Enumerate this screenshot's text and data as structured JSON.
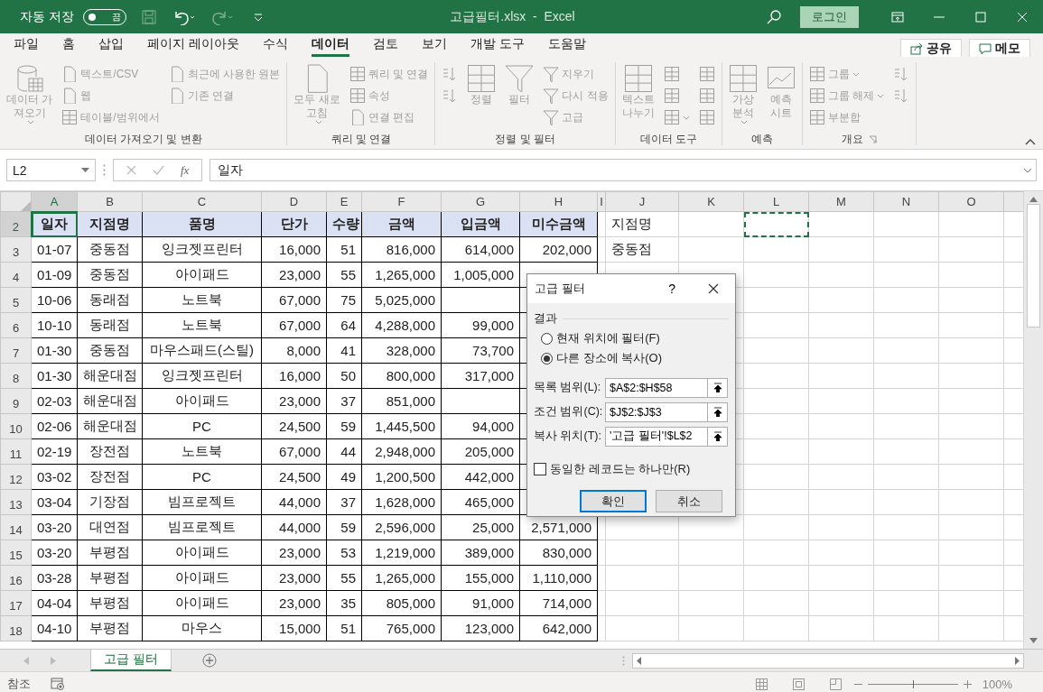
{
  "title_bar": {
    "autosave_label": "자동 저장",
    "autosave_toggle": {
      "label": "끔",
      "on": false
    },
    "title": "고급필터.xlsx  -  Excel",
    "login": "로그인"
  },
  "tabs": [
    {
      "label": "파일",
      "selected": false
    },
    {
      "label": "홈",
      "selected": false
    },
    {
      "label": "삽입",
      "selected": false
    },
    {
      "label": "페이지 레이아웃",
      "selected": false
    },
    {
      "label": "수식",
      "selected": false
    },
    {
      "label": "데이터",
      "selected": true
    },
    {
      "label": "검토",
      "selected": false
    },
    {
      "label": "보기",
      "selected": false
    },
    {
      "label": "개발 도구",
      "selected": false
    },
    {
      "label": "도움말",
      "selected": false
    }
  ],
  "share_button": "공유",
  "comments_button": "메모",
  "ribbon": [
    {
      "label": "데이터 가져오기 및 변환",
      "launcher": false,
      "items": [
        {
          "kind": "large",
          "label": "데이터 가\n져오기",
          "dropdown": true,
          "disabled": true
        },
        {
          "kind": "small",
          "label": "텍스트/CSV",
          "dropdown": false,
          "disabled": true
        },
        {
          "kind": "small",
          "label": "웹",
          "dropdown": false,
          "disabled": true
        },
        {
          "kind": "small",
          "label": "테이블/범위에서",
          "dropdown": false,
          "disabled": true
        },
        {
          "kind": "colbreak"
        },
        {
          "kind": "small",
          "label": "최근에 사용한 원본",
          "dropdown": false,
          "disabled": true
        },
        {
          "kind": "small",
          "label": "기존 연결",
          "dropdown": false,
          "disabled": true
        }
      ]
    },
    {
      "label": "쿼리 및 연결",
      "launcher": false,
      "items": [
        {
          "kind": "large",
          "label": "모두 새로\n고침",
          "dropdown": true,
          "disabled": true
        },
        {
          "kind": "small",
          "label": "쿼리 및 연결",
          "dropdown": false,
          "disabled": true
        },
        {
          "kind": "small",
          "label": "속성",
          "dropdown": false,
          "disabled": true
        },
        {
          "kind": "small",
          "label": "연결 편집",
          "dropdown": false,
          "disabled": true
        }
      ]
    },
    {
      "label": "정렬 및 필터",
      "launcher": false,
      "items": [
        {
          "kind": "icon",
          "dropdown": false,
          "disabled": true
        },
        {
          "kind": "icon",
          "dropdown": false,
          "disabled": true
        },
        {
          "kind": "large",
          "label": "정렬",
          "dropdown": false,
          "disabled": true
        },
        {
          "kind": "large",
          "label": "필터",
          "dropdown": false,
          "disabled": true
        },
        {
          "kind": "small",
          "label": "지우기",
          "dropdown": false,
          "disabled": true
        },
        {
          "kind": "small",
          "label": "다시 적용",
          "dropdown": false,
          "disabled": true
        },
        {
          "kind": "small",
          "label": "고급",
          "dropdown": false,
          "disabled": true
        }
      ]
    },
    {
      "label": "데이터 도구",
      "launcher": false,
      "items": [
        {
          "kind": "large",
          "label": "텍스트\n나누기",
          "dropdown": false,
          "disabled": true
        },
        {
          "kind": "icon",
          "dropdown": false,
          "disabled": true
        },
        {
          "kind": "icon",
          "dropdown": false,
          "disabled": true
        },
        {
          "kind": "icon",
          "dropdown": true,
          "disabled": true
        },
        {
          "kind": "icon",
          "dropdown": false,
          "disabled": true
        },
        {
          "kind": "icon",
          "dropdown": false,
          "disabled": true
        },
        {
          "kind": "icon",
          "dropdown": false,
          "disabled": true
        }
      ]
    },
    {
      "label": "예측",
      "launcher": false,
      "items": [
        {
          "kind": "large",
          "label": "가상\n분석",
          "dropdown": true,
          "disabled": true
        },
        {
          "kind": "large",
          "label": "예측\n시트",
          "dropdown": false,
          "disabled": true
        }
      ]
    },
    {
      "label": "개요",
      "launcher": true,
      "items": [
        {
          "kind": "small",
          "label": "그룹",
          "dropdown": true,
          "disabled": true
        },
        {
          "kind": "small",
          "label": "그룹 해제",
          "dropdown": true,
          "disabled": true
        },
        {
          "kind": "small",
          "label": "부분합",
          "dropdown": false,
          "disabled": true
        },
        {
          "kind": "icon",
          "dropdown": false,
          "disabled": true
        },
        {
          "kind": "icon",
          "dropdown": false,
          "disabled": true
        }
      ]
    }
  ],
  "formula_bar": {
    "name_box": "L2",
    "function_button": "fx",
    "value": "일자"
  },
  "columns": [
    {
      "label": "A",
      "selected": true
    },
    {
      "label": "B",
      "selected": false
    },
    {
      "label": "C",
      "selected": false
    },
    {
      "label": "D",
      "selected": false
    },
    {
      "label": "E",
      "selected": false
    },
    {
      "label": "F",
      "selected": false
    },
    {
      "label": "G",
      "selected": false
    },
    {
      "label": "H",
      "selected": false
    },
    {
      "label": "I",
      "selected": false
    },
    {
      "label": "J",
      "selected": false
    },
    {
      "label": "K",
      "selected": false
    },
    {
      "label": "L",
      "selected": false
    },
    {
      "label": "M",
      "selected": false
    },
    {
      "label": "N",
      "selected": false
    },
    {
      "label": "O",
      "selected": false
    }
  ],
  "rows": [
    {
      "number": "2",
      "selected": true,
      "marquee_l": true,
      "column_j": "지점명",
      "cells": [
        "일자",
        "지점명",
        "품명",
        "단가",
        "수량",
        "금액",
        "입금액",
        "미수금액"
      ]
    },
    {
      "number": "3",
      "selected": false,
      "marquee_l": false,
      "column_j": "중동점",
      "cells": [
        "01-07",
        "중동점",
        "잉크젯프린터",
        "16,000",
        "51",
        "816,000",
        "614,000",
        "202,000"
      ]
    },
    {
      "number": "4",
      "selected": false,
      "marquee_l": false,
      "cells": [
        "01-09",
        "중동점",
        "아이패드",
        "23,000",
        "55",
        "1,265,000",
        "1,005,000"
      ]
    },
    {
      "number": "5",
      "selected": false,
      "marquee_l": false,
      "cells": [
        "10-06",
        "동래점",
        "노트북",
        "67,000",
        "75",
        "5,025,000",
        null
      ]
    },
    {
      "number": "6",
      "selected": false,
      "marquee_l": false,
      "cells": [
        "10-10",
        "동래점",
        "노트북",
        "67,000",
        "64",
        "4,288,000",
        "99,000"
      ]
    },
    {
      "number": "7",
      "selected": false,
      "marquee_l": false,
      "cells": [
        "01-30",
        "중동점",
        "마우스패드(스틸)",
        "8,000",
        "41",
        "328,000",
        "73,700"
      ]
    },
    {
      "number": "8",
      "selected": false,
      "marquee_l": false,
      "cells": [
        "01-30",
        "해운대점",
        "잉크젯프린터",
        "16,000",
        "50",
        "800,000",
        "317,000"
      ]
    },
    {
      "number": "9",
      "selected": false,
      "marquee_l": false,
      "cells": [
        "02-03",
        "해운대점",
        "아이패드",
        "23,000",
        "37",
        "851,000",
        null
      ]
    },
    {
      "number": "10",
      "selected": false,
      "marquee_l": false,
      "cells": [
        "02-06",
        "해운대점",
        "PC",
        "24,500",
        "59",
        "1,445,500",
        "94,000"
      ]
    },
    {
      "number": "11",
      "selected": false,
      "marquee_l": false,
      "cells": [
        "02-19",
        "장전점",
        "노트북",
        "67,000",
        "44",
        "2,948,000",
        "205,000"
      ]
    },
    {
      "number": "12",
      "selected": false,
      "marquee_l": false,
      "cells": [
        "03-02",
        "장전점",
        "PC",
        "24,500",
        "49",
        "1,200,500",
        "442,000"
      ]
    },
    {
      "number": "13",
      "selected": false,
      "marquee_l": false,
      "cells": [
        "03-04",
        "기장점",
        "빔프로젝트",
        "44,000",
        "37",
        "1,628,000",
        "465,000"
      ]
    },
    {
      "number": "14",
      "selected": false,
      "marquee_l": false,
      "cells": [
        "03-20",
        "대연점",
        "빔프로젝트",
        "44,000",
        "59",
        "2,596,000",
        "25,000",
        "2,571,000"
      ]
    },
    {
      "number": "15",
      "selected": false,
      "marquee_l": false,
      "cells": [
        "03-20",
        "부평점",
        "아이패드",
        "23,000",
        "53",
        "1,219,000",
        "389,000",
        "830,000"
      ]
    },
    {
      "number": "16",
      "selected": false,
      "marquee_l": false,
      "cells": [
        "03-28",
        "부평점",
        "아이패드",
        "23,000",
        "55",
        "1,265,000",
        "155,000",
        "1,110,000"
      ]
    },
    {
      "number": "17",
      "selected": false,
      "marquee_l": false,
      "cells": [
        "04-04",
        "부평점",
        "아이패드",
        "23,000",
        "35",
        "805,000",
        "91,000",
        "714,000"
      ]
    },
    {
      "number": "18",
      "selected": false,
      "marquee_l": false,
      "cells": [
        "04-10",
        "부평점",
        "마우스",
        "15,000",
        "51",
        "765,000",
        "123,000",
        "642,000"
      ]
    }
  ],
  "dialog": {
    "title": "고급 필터",
    "help": "?",
    "section": "결과",
    "options": [
      {
        "label": "현재 위치에 필터(F)",
        "selected": false
      },
      {
        "label": "다른 장소에 복사(O)",
        "selected": true
      }
    ],
    "fields": [
      {
        "label": "목록 범위(L):",
        "value": "$A$2:$H$58"
      },
      {
        "label": "조건 범위(C):",
        "value": "$J$2:$J$3"
      },
      {
        "label": "복사 위치(T):",
        "value": "'고급 필터'!$L$2"
      }
    ],
    "unique": {
      "label": "동일한 레코드는 하나만(R)",
      "checked": false
    },
    "buttons": [
      {
        "label": "확인",
        "default": true
      },
      {
        "label": "취소",
        "default": false
      }
    ]
  },
  "sheet_tabs": [
    {
      "label": "고급 필터",
      "selected": true
    }
  ],
  "status_bar": {
    "mode": "참조",
    "zoom": {
      "level": 0.5,
      "reading": "100%"
    }
  }
}
